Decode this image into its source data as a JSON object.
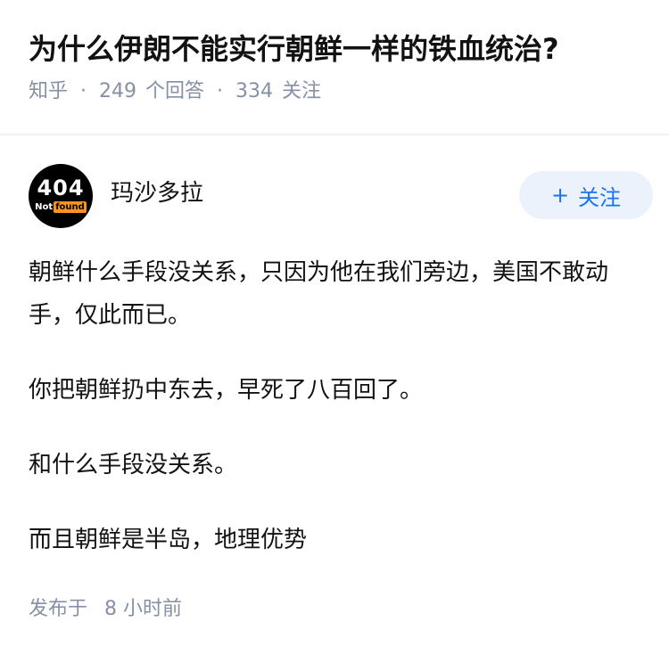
{
  "question": {
    "title": "为什么伊朗不能实行朝鲜一样的铁血统治?",
    "source": "知乎",
    "answer_count": "249",
    "answer_label": "个回答",
    "follower_count": "334",
    "follower_label": "关注",
    "separator": "·"
  },
  "author": {
    "avatar": {
      "code": "404",
      "text_not": "Not",
      "text_found": "found"
    },
    "name": "玛沙多拉",
    "follow_button": {
      "icon": "+",
      "label": "关注"
    }
  },
  "answer": {
    "paragraphs": [
      "朝鲜什么手段没关系，只因为他在我们旁边，美国不敢动手，仅此而已。",
      "你把朝鲜扔中东去，早死了八百回了。",
      "和什么手段没关系。",
      "而且朝鲜是半岛，地理优势"
    ],
    "published_label": "发布于",
    "published_time": "8 小时前"
  },
  "colors": {
    "meta_gray": "#8590a6",
    "accent_blue": "#1772f6",
    "button_bg": "#ebf2fb",
    "avatar_badge": "#f7931e"
  }
}
